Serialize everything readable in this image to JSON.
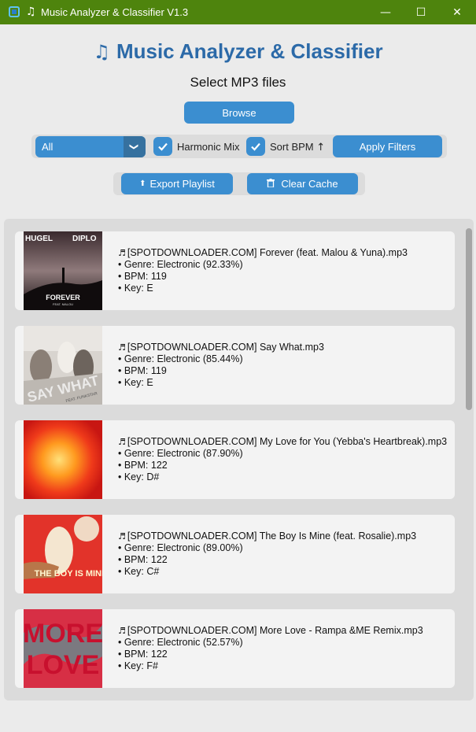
{
  "window": {
    "title": "Music Analyzer & Classifier V1.3",
    "note_glyph": "♫",
    "controls": {
      "minimize": "—",
      "maximize": "☐",
      "close": "✕"
    }
  },
  "header": {
    "icon": "♫",
    "title": "Music Analyzer & Classifier",
    "subtitle": "Select MP3 files"
  },
  "toolbar": {
    "browse_label": "Browse",
    "filter_value": "All",
    "filter_arrow": "❯",
    "harmonic_mix": {
      "label": "Harmonic Mix",
      "checked": true
    },
    "sort_bpm": {
      "label": "Sort BPM",
      "arrow": "↑",
      "checked": true
    },
    "apply_label": "Apply Filters",
    "export_label": "Export Playlist",
    "export_icon": "⬆",
    "clear_label": "Clear Cache",
    "clear_icon": "🗑"
  },
  "tracks": [
    {
      "title": "[SPOTDOWNLOADER.COM] Forever (feat. Malou & Yuna).mp3",
      "genre": "• Genre: Electronic (92.33%)",
      "bpm": "• BPM: 119",
      "key": "• Key: E",
      "art": {
        "top": "HUGEL",
        "top2": "DIPLO",
        "bottom": "FOREVER",
        "sub": "FEAT. MALOU"
      }
    },
    {
      "title": "[SPOTDOWNLOADER.COM] Say What.mp3",
      "genre": "• Genre: Electronic (85.44%)",
      "bpm": "• BPM: 119",
      "key": "• Key: E",
      "art": {
        "text": "SAY WHAT",
        "sub": "FEAT. FUNKSTAR"
      }
    },
    {
      "title": "[SPOTDOWNLOADER.COM] My Love for You (Yebba's Heartbreak).mp3",
      "genre": "• Genre: Electronic (87.90%)",
      "bpm": "• BPM: 122",
      "key": "• Key: D#",
      "art": {}
    },
    {
      "title": "[SPOTDOWNLOADER.COM] The Boy Is Mine (feat. Rosalie).mp3",
      "genre": "• Genre: Electronic (89.00%)",
      "bpm": "• BPM: 122",
      "key": "• Key: C#",
      "art": {
        "text": "THE BOY IS MINE"
      }
    },
    {
      "title": "[SPOTDOWNLOADER.COM] More Love - Rampa &ME Remix.mp3",
      "genre": "• Genre: Electronic (52.57%)",
      "bpm": "• BPM: 122",
      "key": "• Key: F#",
      "art": {
        "text": "MORE LOVE"
      }
    }
  ],
  "colors": {
    "titlebar": "#4e840d",
    "accent": "#3b8ed0",
    "heading": "#2c6aa8"
  }
}
